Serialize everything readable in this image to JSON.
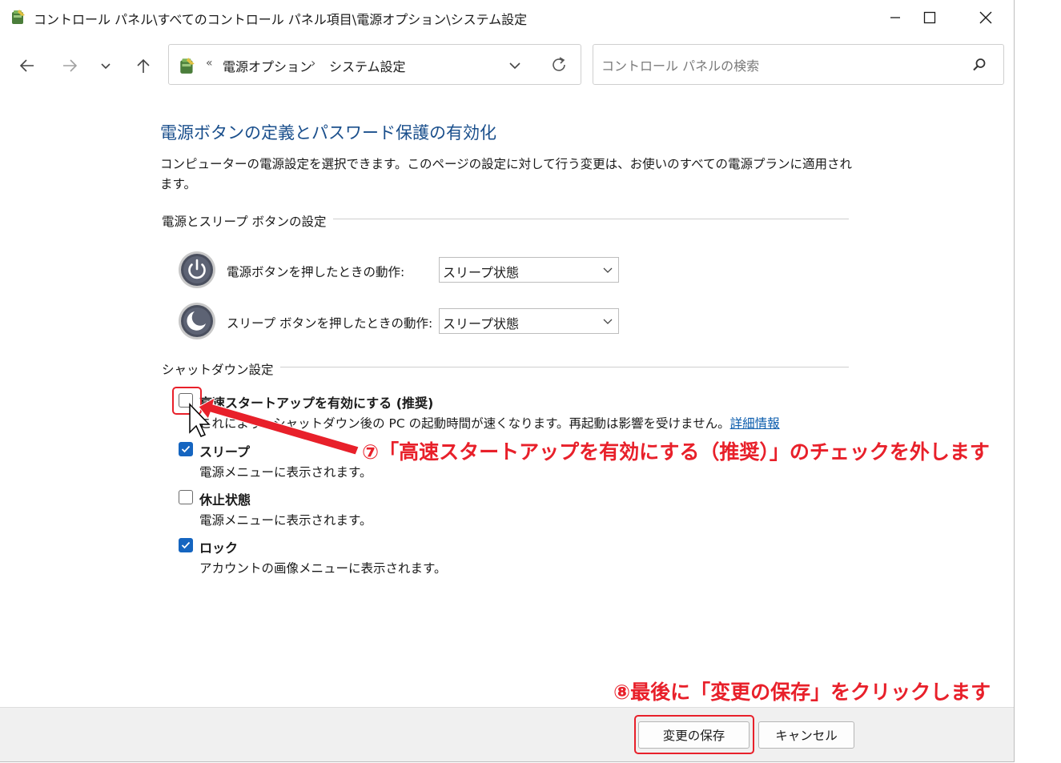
{
  "window": {
    "title": "コントロール パネル\\すべてのコントロール パネル項目\\電源オプション\\システム設定"
  },
  "address": {
    "overflow": "«",
    "crumbs": [
      "電源オプション",
      "システム設定"
    ],
    "separator": "›"
  },
  "search": {
    "placeholder": "コントロール パネルの検索"
  },
  "page": {
    "heading": "電源ボタンの定義とパスワード保護の有効化",
    "description": "コンピューターの電源設定を選択できます。このページの設定に対して行う変更は、お使いのすべての電源プランに適用されます。"
  },
  "power_section": {
    "label": "電源とスリープ ボタンの設定",
    "rows": [
      {
        "label": "電源ボタンを押したときの動作:",
        "value": "スリープ状態"
      },
      {
        "label": "スリープ ボタンを押したときの動作:",
        "value": "スリープ状態"
      }
    ]
  },
  "shutdown_section": {
    "label": "シャットダウン設定",
    "items": [
      {
        "title": "高速スタートアップを有効にする (推奨)",
        "desc": "これにより、シャットダウン後の PC の起動時間が速くなります。再起動は影響を受けません。",
        "link": "詳細情報",
        "checked": false
      },
      {
        "title": "スリープ",
        "desc": "電源メニューに表示されます。",
        "checked": true
      },
      {
        "title": "休止状態",
        "desc": "電源メニューに表示されます。",
        "checked": false
      },
      {
        "title": "ロック",
        "desc": "アカウントの画像メニューに表示されます。",
        "checked": true
      }
    ]
  },
  "footer": {
    "save": "変更の保存",
    "cancel": "キャンセル"
  },
  "annotations": {
    "step7": "⑦「高速スタートアップを有効にする（推奨）」のチェックを外します",
    "step8": "⑧最後に「変更の保存」をクリックします"
  },
  "colors": {
    "heading": "#1a4f8c",
    "checkbox": "#1565c0",
    "annotation": "#e8202a",
    "link": "#0b5cad"
  }
}
